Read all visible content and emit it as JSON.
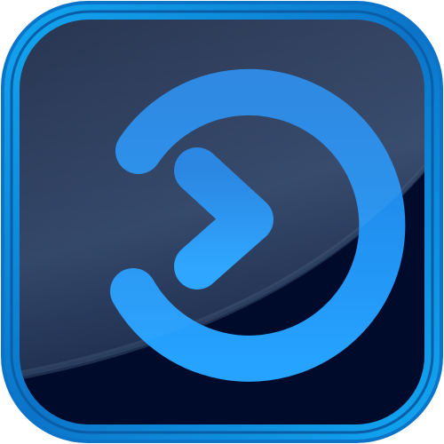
{
  "icon": {
    "name": "login-icon",
    "colors": {
      "frame_outer": "#0b74c8",
      "frame_bright": "#12a8f2",
      "frame_inner_edge": "#0a5ea8",
      "panel_top": "#2a3f63",
      "panel_mid": "#12203f",
      "panel_bottom": "#000a2a",
      "glyph_top": "#1c7fe0",
      "glyph_bottom": "#26a2ff",
      "gloss": "#ffffff"
    }
  }
}
